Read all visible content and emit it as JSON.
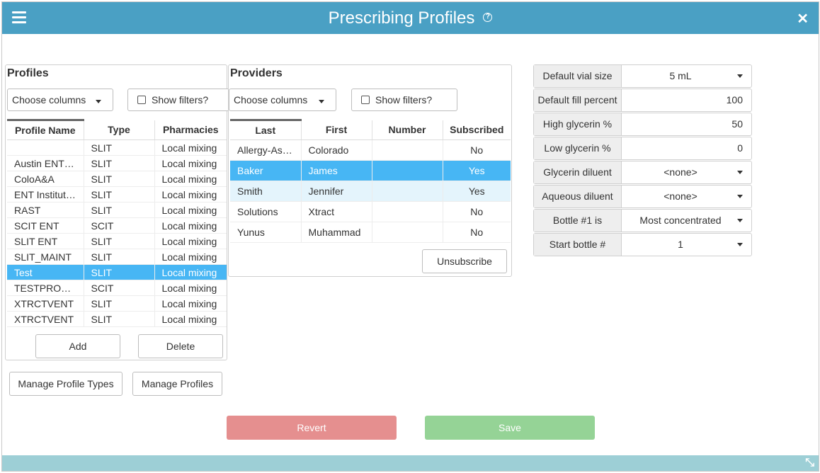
{
  "header": {
    "title": "Prescribing Profiles"
  },
  "profiles": {
    "title": "Profiles",
    "choose_columns": "Choose columns",
    "show_filters": "Show filters?",
    "columns": [
      "Profile Name",
      "Type",
      "Pharmacies"
    ],
    "rows": [
      [
        "",
        "SLIT",
        "Local mixing"
      ],
      [
        "Austin ENT…",
        "SLIT",
        "Local mixing"
      ],
      [
        "ColoA&A",
        "SLIT",
        "Local mixing"
      ],
      [
        "ENT Institut…",
        "SLIT",
        "Local mixing"
      ],
      [
        "RAST",
        "SLIT",
        "Local mixing"
      ],
      [
        "SCIT ENT",
        "SCIT",
        "Local mixing"
      ],
      [
        "SLIT ENT",
        "SLIT",
        "Local mixing"
      ],
      [
        "SLIT_MAINT",
        "SLIT",
        "Local mixing"
      ],
      [
        "Test",
        "SLIT",
        "Local mixing"
      ],
      [
        "TESTPRO…",
        "SCIT",
        "Local mixing"
      ],
      [
        "XTRCTVENT",
        "SLIT",
        "Local mixing"
      ],
      [
        "XTRCTVENT",
        "SLIT",
        "Local mixing"
      ]
    ],
    "selected_row": 8,
    "add_label": "Add",
    "delete_label": "Delete"
  },
  "manage": {
    "profile_types_label": "Manage Profile Types",
    "profiles_label": "Manage Profiles"
  },
  "providers": {
    "title": "Providers",
    "choose_columns": "Choose columns",
    "show_filters": "Show filters?",
    "columns": [
      "Last",
      "First",
      "Number",
      "Subscribed"
    ],
    "rows": [
      [
        "Allergy-As…",
        "Colorado",
        "",
        "No"
      ],
      [
        "Baker",
        "James",
        "",
        "Yes"
      ],
      [
        "Smith",
        "Jennifer",
        "",
        "Yes"
      ],
      [
        "Solutions",
        "Xtract",
        "",
        "No"
      ],
      [
        "Yunus",
        "Muhammad",
        "",
        "No"
      ]
    ],
    "selected_row": 1,
    "hover_row": 2,
    "unsubscribe_label": "Unsubscribe"
  },
  "settings": [
    {
      "label": "Default vial size",
      "value": "5 mL",
      "kind": "select"
    },
    {
      "label": "Default fill percent",
      "value": "100",
      "kind": "number"
    },
    {
      "label": "High glycerin %",
      "value": "50",
      "kind": "number"
    },
    {
      "label": "Low glycerin %",
      "value": "0",
      "kind": "number"
    },
    {
      "label": "Glycerin diluent",
      "value": "<none>",
      "kind": "select"
    },
    {
      "label": "Aqueous diluent",
      "value": "<none>",
      "kind": "select"
    },
    {
      "label": "Bottle #1 is",
      "value": "Most concentrated",
      "kind": "select"
    },
    {
      "label": "Start bottle #",
      "value": "1",
      "kind": "select"
    }
  ],
  "actions": {
    "revert_label": "Revert",
    "save_label": "Save",
    "revert_color": "#e58f8f",
    "save_color": "#95d396"
  },
  "icons": {
    "menu": "hamburger-icon",
    "help": "help-circle-icon",
    "close": "close-icon",
    "resize": "resize-icon"
  }
}
